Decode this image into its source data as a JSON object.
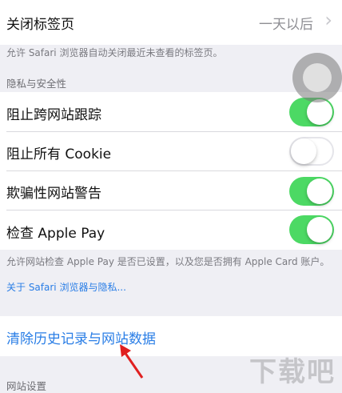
{
  "close_tabs": {
    "label": "关闭标签页",
    "value": "一天以后",
    "chevron": "›",
    "footer": "允许 Safari 浏览器自动关闭最近未查看的标签页。"
  },
  "privacy_section": {
    "header": "隐私与安全性",
    "items": [
      {
        "label": "阻止跨网站跟踪",
        "state": "on"
      },
      {
        "label": "阻止所有 Cookie",
        "state": "off"
      },
      {
        "label": "欺骗性网站警告",
        "state": "on"
      },
      {
        "label": "检查 Apple Pay",
        "state": "on"
      }
    ],
    "footer": "允许网站检查 Apple Pay 是否已设置，以及您是否拥有 Apple Card 账户。",
    "footer_link": "关于 Safari 浏览器与隐私..."
  },
  "clear_history": {
    "label": "清除历史记录与网站数据"
  },
  "website_settings_header": "网站设置",
  "watermark": "下载吧"
}
